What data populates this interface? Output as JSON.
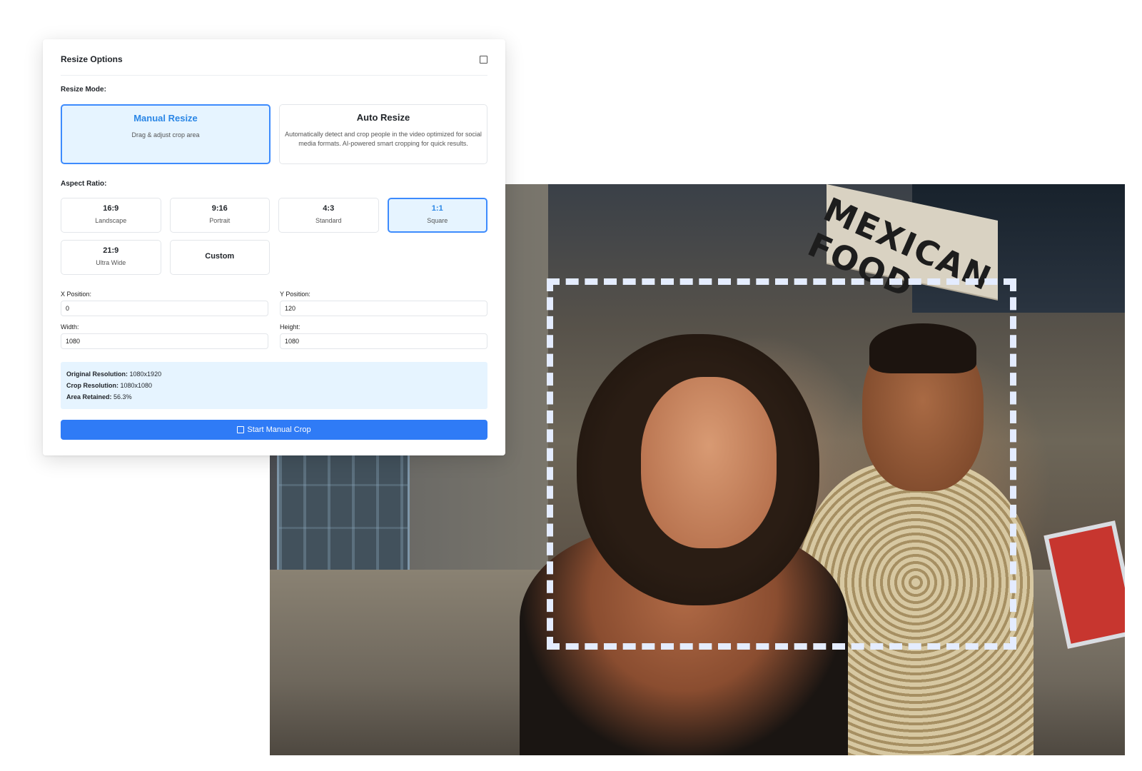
{
  "panel": {
    "title": "Resize Options",
    "resize_mode_label": "Resize Mode:",
    "modes": [
      {
        "title": "Manual Resize",
        "desc": "Drag & adjust crop area",
        "active": true
      },
      {
        "title": "Auto Resize",
        "desc": "Automatically detect and crop people in the video optimized for social media formats. AI-powered smart cropping for quick results.",
        "active": false
      }
    ],
    "aspect_ratio_label": "Aspect Ratio:",
    "ratios": [
      {
        "name": "16:9",
        "sub": "Landscape"
      },
      {
        "name": "9:16",
        "sub": "Portrait"
      },
      {
        "name": "4:3",
        "sub": "Standard"
      },
      {
        "name": "1:1",
        "sub": "Square"
      },
      {
        "name": "21:9",
        "sub": "Ultra Wide"
      },
      {
        "name": "Custom",
        "sub": ""
      }
    ],
    "fields": {
      "x_label": "X Position:",
      "x_value": "0",
      "y_label": "Y Position:",
      "y_value": "120",
      "w_label": "Width:",
      "w_value": "1080",
      "h_label": "Height:",
      "h_value": "1080"
    },
    "info": {
      "original_label": "Original Resolution:",
      "original_value": "1080x1920",
      "crop_label": "Crop Resolution:",
      "crop_value": "1080x1080",
      "area_label": "Area Retained:",
      "area_value": "56.3%"
    },
    "start_button": "Start Manual Crop"
  },
  "photo": {
    "sign_text": "MEXICAN FOOD"
  },
  "icons": {
    "maximize": "maximize-icon",
    "crop": "square-icon"
  },
  "colors": {
    "accent": "#2f7bf6",
    "active_border": "#3d8bfd",
    "active_bg": "#e6f4ff",
    "crop_outline": "#e4ecff"
  }
}
